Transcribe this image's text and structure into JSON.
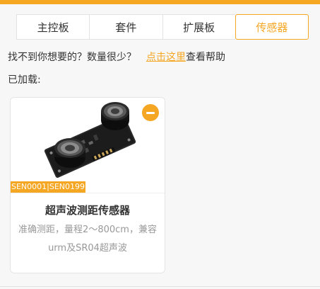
{
  "colors": {
    "accent": "#f5a623",
    "tab_border": "#e2e2e2",
    "muted_text": "#999999"
  },
  "tabs": [
    {
      "label": "主控板",
      "active": false
    },
    {
      "label": "套件",
      "active": false
    },
    {
      "label": "扩展板",
      "active": false
    },
    {
      "label": "传感器",
      "active": true
    }
  ],
  "help": {
    "prefix": "找不到你想要的？数量很少？",
    "link": "点击这里",
    "suffix": "查看帮助"
  },
  "loaded_label": "已加载:",
  "card": {
    "sku": "SEN0001|SEN0199",
    "title": "超声波测距传感器",
    "description": "准确测距，量程2～800cm，兼容urm及SR04超声波",
    "image_icon": "ultrasonic-sensor-image",
    "remove_icon": "minus-circle-icon"
  }
}
